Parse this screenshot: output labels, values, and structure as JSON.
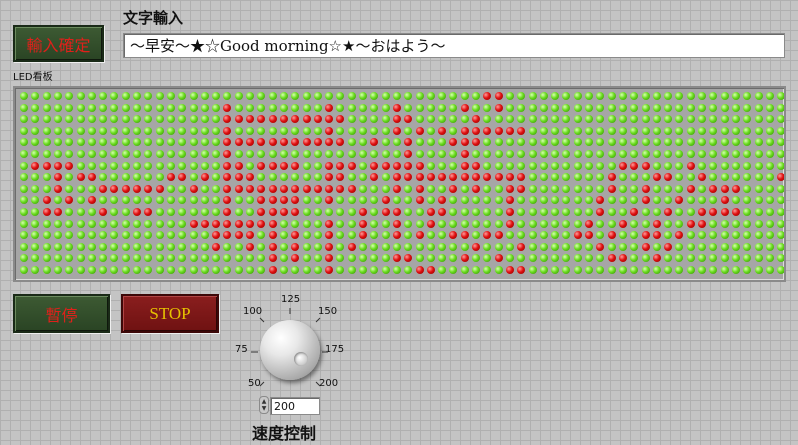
{
  "confirm_button": {
    "label": "輸入確定"
  },
  "text_input": {
    "label": "文字輸入",
    "value": "～早安～★☆Good morning☆★～おはよう～"
  },
  "led_board": {
    "label": "LED看板",
    "rows": 16,
    "cols": 68,
    "lit_runs": [
      [
        [
          41,
          41
        ],
        [
          42,
          42
        ]
      ],
      [
        [
          18,
          18
        ],
        [
          27,
          27
        ],
        [
          33,
          33
        ],
        [
          39,
          39
        ],
        [
          42,
          42
        ]
      ],
      [
        [
          18,
          28
        ],
        [
          33,
          34
        ],
        [
          40,
          40
        ]
      ],
      [
        [
          18,
          18
        ],
        [
          27,
          27
        ],
        [
          33,
          33
        ],
        [
          35,
          35
        ],
        [
          37,
          37
        ],
        [
          39,
          44
        ]
      ],
      [
        [
          18,
          28
        ],
        [
          31,
          31
        ],
        [
          34,
          34
        ],
        [
          38,
          40
        ]
      ],
      [
        [
          18,
          18
        ],
        [
          34,
          34
        ],
        [
          39,
          39
        ]
      ],
      [
        [
          1,
          4
        ],
        [
          18,
          19
        ],
        [
          21,
          24
        ],
        [
          27,
          28
        ],
        [
          29,
          29
        ],
        [
          31,
          33
        ],
        [
          34,
          35
        ],
        [
          39,
          40
        ],
        [
          53,
          55
        ],
        [
          59,
          59
        ]
      ],
      [
        [
          3,
          3
        ],
        [
          5,
          6
        ],
        [
          13,
          14
        ],
        [
          16,
          16
        ],
        [
          18,
          20
        ],
        [
          27,
          28
        ],
        [
          31,
          31
        ],
        [
          33,
          44
        ],
        [
          52,
          52
        ],
        [
          56,
          57
        ],
        [
          60,
          60
        ],
        [
          67,
          67
        ]
      ],
      [
        [
          3,
          3
        ],
        [
          7,
          12
        ],
        [
          15,
          15
        ],
        [
          18,
          29
        ],
        [
          33,
          33
        ],
        [
          35,
          35
        ],
        [
          38,
          38
        ],
        [
          40,
          40
        ],
        [
          43,
          44
        ],
        [
          52,
          52
        ],
        [
          55,
          55
        ],
        [
          59,
          59
        ],
        [
          61,
          63
        ]
      ],
      [
        [
          2,
          2
        ],
        [
          4,
          4
        ],
        [
          6,
          6
        ],
        [
          18,
          18
        ],
        [
          21,
          24
        ],
        [
          27,
          27
        ],
        [
          32,
          32
        ],
        [
          35,
          35
        ],
        [
          37,
          37
        ],
        [
          43,
          43
        ],
        [
          51,
          51
        ],
        [
          55,
          55
        ],
        [
          58,
          58
        ],
        [
          62,
          62
        ]
      ],
      [
        [
          2,
          3
        ],
        [
          7,
          7
        ],
        [
          10,
          11
        ],
        [
          18,
          18
        ],
        [
          21,
          24
        ],
        [
          30,
          30
        ],
        [
          32,
          33
        ],
        [
          36,
          37
        ],
        [
          43,
          43
        ],
        [
          51,
          51
        ],
        [
          54,
          54
        ],
        [
          57,
          57
        ],
        [
          60,
          63
        ]
      ],
      [
        [
          15,
          22
        ],
        [
          27,
          27
        ],
        [
          30,
          30
        ],
        [
          33,
          33
        ],
        [
          36,
          36
        ],
        [
          43,
          43
        ],
        [
          50,
          50
        ],
        [
          53,
          53
        ],
        [
          56,
          56
        ],
        [
          59,
          60
        ]
      ],
      [
        [
          17,
          20
        ],
        [
          22,
          22
        ],
        [
          24,
          24
        ],
        [
          27,
          27
        ],
        [
          30,
          30
        ],
        [
          33,
          33
        ],
        [
          35,
          35
        ],
        [
          38,
          39
        ],
        [
          41,
          42
        ],
        [
          49,
          50
        ],
        [
          52,
          52
        ],
        [
          55,
          56
        ],
        [
          58,
          58
        ]
      ],
      [
        [
          17,
          17
        ],
        [
          20,
          20
        ],
        [
          22,
          22
        ],
        [
          24,
          24
        ],
        [
          27,
          27
        ],
        [
          29,
          29
        ],
        [
          40,
          40
        ],
        [
          44,
          44
        ],
        [
          51,
          51
        ],
        [
          55,
          55
        ],
        [
          57,
          57
        ]
      ],
      [
        [
          22,
          22
        ],
        [
          24,
          24
        ],
        [
          27,
          27
        ],
        [
          33,
          34
        ],
        [
          39,
          39
        ],
        [
          42,
          42
        ],
        [
          52,
          53
        ],
        [
          56,
          56
        ]
      ],
      [
        [
          22,
          22
        ],
        [
          27,
          27
        ],
        [
          35,
          36
        ],
        [
          43,
          44
        ]
      ]
    ]
  },
  "pause_button": {
    "label": "暫停"
  },
  "stop_button": {
    "label": "STOP"
  },
  "speed_control": {
    "label": "速度控制",
    "value": "200",
    "min": 50,
    "max": 200,
    "ticks": [
      "50",
      "75",
      "100",
      "125",
      "150",
      "175",
      "200"
    ]
  },
  "colors": {
    "led_on": "#e01010",
    "led_off": "#6adc1e",
    "confirm_button_bg": "#2f4a29",
    "stop_button_bg": "#7c1818",
    "label_red": "#e0201a",
    "stop_label": "#e6c200"
  },
  "icons": {
    "speed_spinner": "up-down-arrows-icon"
  }
}
